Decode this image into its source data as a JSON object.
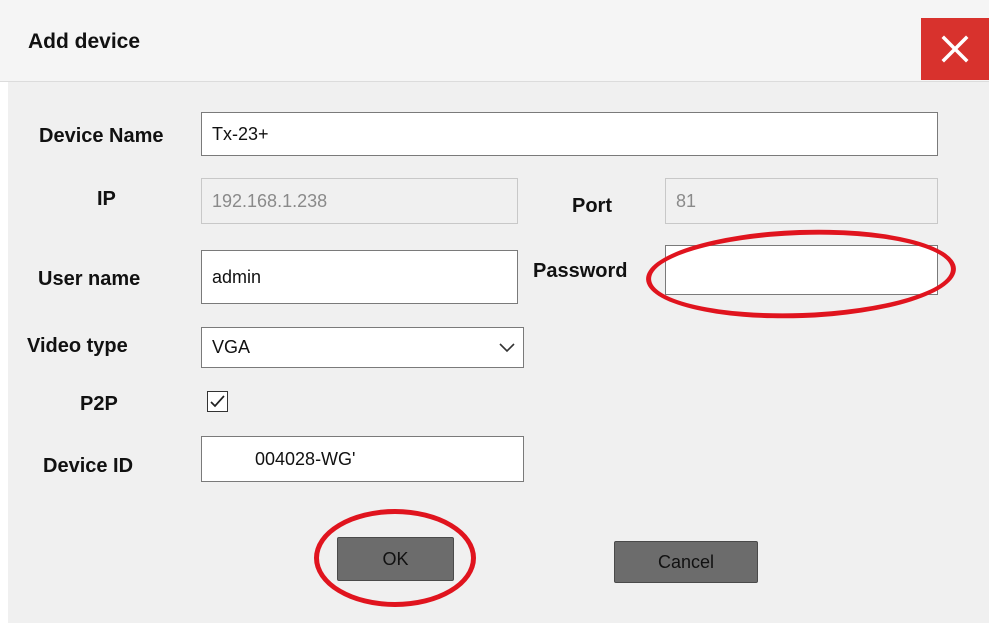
{
  "dialog": {
    "title": "Add device",
    "close_icon": "close-x-icon",
    "accent_close_color": "#d8322d"
  },
  "form": {
    "device_name": {
      "label": "Device Name",
      "value": "Tx-23+"
    },
    "ip": {
      "label": "IP",
      "value": "192.168.1.238"
    },
    "port": {
      "label": "Port",
      "value": "81"
    },
    "username": {
      "label": "User name",
      "value": "admin"
    },
    "password": {
      "label": "Password",
      "value": ""
    },
    "video_type": {
      "label": "Video type",
      "selected": "VGA",
      "icon": "chevron-down-icon"
    },
    "p2p": {
      "label": "P2P",
      "checked": true
    },
    "device_id": {
      "label": "Device ID",
      "value": "004028-WG'"
    }
  },
  "buttons": {
    "ok_label": "OK",
    "cancel_label": "Cancel"
  },
  "annotations": {
    "highlight_color": "#e0141e",
    "targets": [
      "password-field",
      "ok-button"
    ]
  }
}
